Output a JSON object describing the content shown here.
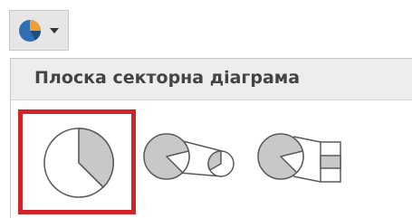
{
  "toolbar": {
    "chart_type_icon": "pie-chart-icon",
    "dropdown_icon": "chevron-down-icon"
  },
  "menu": {
    "header": "Плоска секторна діаграма",
    "options": [
      {
        "icon": "flat-pie-icon",
        "selected": true
      },
      {
        "icon": "pie-of-pie-icon",
        "selected": false
      },
      {
        "icon": "bar-of-pie-icon",
        "selected": false
      }
    ]
  },
  "colors": {
    "highlight": "#d2232a",
    "slice_fill": "#c8c8c8",
    "outline": "#5a5a5a",
    "header_bg": "#ededed",
    "pie_blue": "#2f6fb2",
    "pie_orange": "#f0a030"
  }
}
